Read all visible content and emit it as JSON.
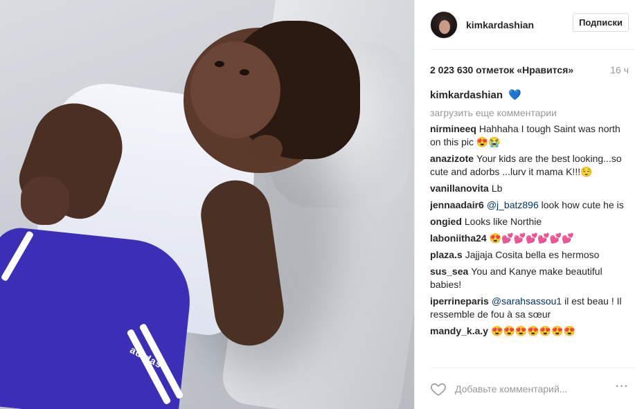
{
  "photo": {
    "alt": "child lying on a cushion",
    "logo_text": "adidas"
  },
  "header": {
    "username": "kimkardashian",
    "follow_button": "Подписки"
  },
  "stats": {
    "likes": "2 023 630 отметок «Нравится»",
    "time": "16 ч"
  },
  "caption": {
    "user": "kimkardashian",
    "text": "💙"
  },
  "load_more": "загрузить еще комментарии",
  "comments": [
    {
      "user": "nirmineeq",
      "text": "Hahhaha I tough Saint was north on this pic 😍😭",
      "mention": ""
    },
    {
      "user": "anazizote",
      "text": "Your kids are the best looking...so cute and adorbs ...lurv it mama K!!!😌",
      "mention": ""
    },
    {
      "user": "vanillanovita",
      "text": "Lb",
      "mention": ""
    },
    {
      "user": "jennaadair6",
      "mention": "@j_batz896",
      "text": " look how cute he is"
    },
    {
      "user": "ongied",
      "text": "Looks like Northie",
      "mention": ""
    },
    {
      "user": "laboniitha24",
      "text": "😍💕💕💕💕💕💕",
      "mention": ""
    },
    {
      "user": "plaza.s",
      "text": "Jajjaja Cosita bella es hermoso",
      "mention": ""
    },
    {
      "user": "sus_sea",
      "text": "You and Kanye make beautiful babies!",
      "mention": ""
    },
    {
      "user": "iperrineparis",
      "mention": "@sarahsassou1",
      "text": " il est beau ! Il ressemble de fou à sa sœur"
    },
    {
      "user": "mandy_k.a.y",
      "text": "😍😍😍😍😍😍😍",
      "mention": ""
    }
  ],
  "footer": {
    "comment_placeholder": "Добавьте комментарий...",
    "more_label": "···"
  },
  "colors": {
    "link": "#003569",
    "muted": "#999999",
    "border": "#efefef",
    "caption_heart": "#3897f0"
  }
}
